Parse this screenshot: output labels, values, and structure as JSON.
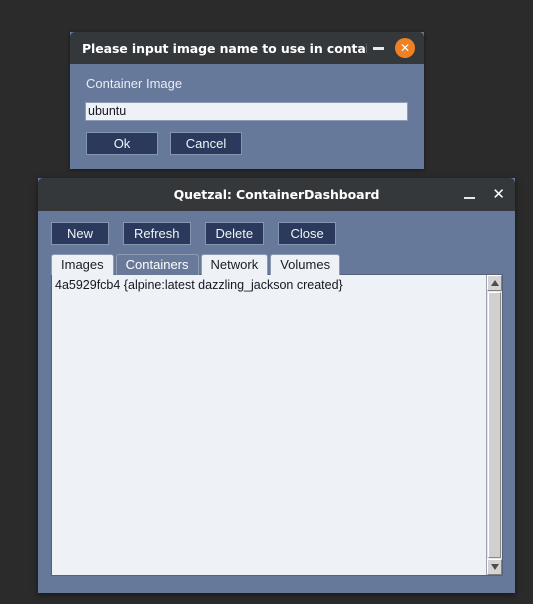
{
  "dialog": {
    "title": "Please input image name to use in container,…",
    "minimize_icon": "minimize-icon",
    "close_icon": "close-icon",
    "close_glyph": "✕",
    "label": "Container Image",
    "input_value": "ubuntu",
    "input_placeholder": "",
    "ok_label": "Ok",
    "cancel_label": "Cancel",
    "accent_color": "#ef8023",
    "titlebar_color": "#35383a",
    "body_color": "#66799a"
  },
  "window": {
    "title": "Quetzal: ContainerDashboard",
    "minimize_icon": "minimize-icon",
    "close_icon": "close-icon",
    "close_glyph": "✕",
    "toolbar": {
      "new_label": "New",
      "refresh_label": "Refresh",
      "delete_label": "Delete",
      "close_label": "Close"
    },
    "tabs": [
      {
        "label": "Images",
        "active": false
      },
      {
        "label": "Containers",
        "active": true
      },
      {
        "label": "Network",
        "active": false
      },
      {
        "label": "Volumes",
        "active": false
      }
    ],
    "list": {
      "rows": [
        "4a5929fcb4 {alpine:latest dazzling_jackson created}"
      ]
    },
    "scrollbar": {
      "up_icon": "scroll-up-arrow-icon",
      "down_icon": "scroll-down-arrow-icon"
    },
    "titlebar_color": "#35383a",
    "body_color": "#66799a"
  },
  "desktop": {
    "background_color": "#2b2b2b"
  }
}
